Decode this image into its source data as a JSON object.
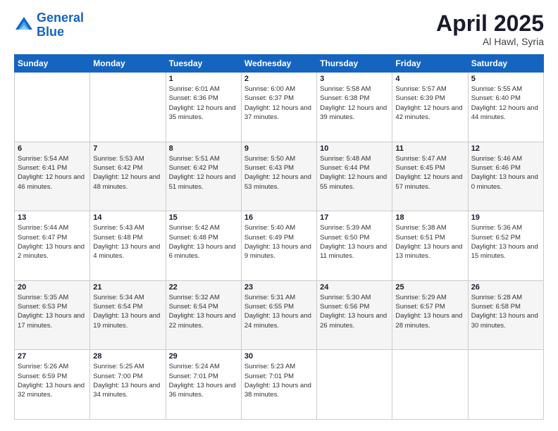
{
  "header": {
    "logo_line1": "General",
    "logo_line2": "Blue",
    "title": "April 2025",
    "subtitle": "Al Hawl, Syria"
  },
  "columns": [
    "Sunday",
    "Monday",
    "Tuesday",
    "Wednesday",
    "Thursday",
    "Friday",
    "Saturday"
  ],
  "weeks": [
    [
      {
        "day": "",
        "sunrise": "",
        "sunset": "",
        "daylight": ""
      },
      {
        "day": "",
        "sunrise": "",
        "sunset": "",
        "daylight": ""
      },
      {
        "day": "1",
        "sunrise": "Sunrise: 6:01 AM",
        "sunset": "Sunset: 6:36 PM",
        "daylight": "Daylight: 12 hours and 35 minutes."
      },
      {
        "day": "2",
        "sunrise": "Sunrise: 6:00 AM",
        "sunset": "Sunset: 6:37 PM",
        "daylight": "Daylight: 12 hours and 37 minutes."
      },
      {
        "day": "3",
        "sunrise": "Sunrise: 5:58 AM",
        "sunset": "Sunset: 6:38 PM",
        "daylight": "Daylight: 12 hours and 39 minutes."
      },
      {
        "day": "4",
        "sunrise": "Sunrise: 5:57 AM",
        "sunset": "Sunset: 6:39 PM",
        "daylight": "Daylight: 12 hours and 42 minutes."
      },
      {
        "day": "5",
        "sunrise": "Sunrise: 5:55 AM",
        "sunset": "Sunset: 6:40 PM",
        "daylight": "Daylight: 12 hours and 44 minutes."
      }
    ],
    [
      {
        "day": "6",
        "sunrise": "Sunrise: 5:54 AM",
        "sunset": "Sunset: 6:41 PM",
        "daylight": "Daylight: 12 hours and 46 minutes."
      },
      {
        "day": "7",
        "sunrise": "Sunrise: 5:53 AM",
        "sunset": "Sunset: 6:42 PM",
        "daylight": "Daylight: 12 hours and 48 minutes."
      },
      {
        "day": "8",
        "sunrise": "Sunrise: 5:51 AM",
        "sunset": "Sunset: 6:42 PM",
        "daylight": "Daylight: 12 hours and 51 minutes."
      },
      {
        "day": "9",
        "sunrise": "Sunrise: 5:50 AM",
        "sunset": "Sunset: 6:43 PM",
        "daylight": "Daylight: 12 hours and 53 minutes."
      },
      {
        "day": "10",
        "sunrise": "Sunrise: 5:48 AM",
        "sunset": "Sunset: 6:44 PM",
        "daylight": "Daylight: 12 hours and 55 minutes."
      },
      {
        "day": "11",
        "sunrise": "Sunrise: 5:47 AM",
        "sunset": "Sunset: 6:45 PM",
        "daylight": "Daylight: 12 hours and 57 minutes."
      },
      {
        "day": "12",
        "sunrise": "Sunrise: 5:46 AM",
        "sunset": "Sunset: 6:46 PM",
        "daylight": "Daylight: 13 hours and 0 minutes."
      }
    ],
    [
      {
        "day": "13",
        "sunrise": "Sunrise: 5:44 AM",
        "sunset": "Sunset: 6:47 PM",
        "daylight": "Daylight: 13 hours and 2 minutes."
      },
      {
        "day": "14",
        "sunrise": "Sunrise: 5:43 AM",
        "sunset": "Sunset: 6:48 PM",
        "daylight": "Daylight: 13 hours and 4 minutes."
      },
      {
        "day": "15",
        "sunrise": "Sunrise: 5:42 AM",
        "sunset": "Sunset: 6:48 PM",
        "daylight": "Daylight: 13 hours and 6 minutes."
      },
      {
        "day": "16",
        "sunrise": "Sunrise: 5:40 AM",
        "sunset": "Sunset: 6:49 PM",
        "daylight": "Daylight: 13 hours and 9 minutes."
      },
      {
        "day": "17",
        "sunrise": "Sunrise: 5:39 AM",
        "sunset": "Sunset: 6:50 PM",
        "daylight": "Daylight: 13 hours and 11 minutes."
      },
      {
        "day": "18",
        "sunrise": "Sunrise: 5:38 AM",
        "sunset": "Sunset: 6:51 PM",
        "daylight": "Daylight: 13 hours and 13 minutes."
      },
      {
        "day": "19",
        "sunrise": "Sunrise: 5:36 AM",
        "sunset": "Sunset: 6:52 PM",
        "daylight": "Daylight: 13 hours and 15 minutes."
      }
    ],
    [
      {
        "day": "20",
        "sunrise": "Sunrise: 5:35 AM",
        "sunset": "Sunset: 6:53 PM",
        "daylight": "Daylight: 13 hours and 17 minutes."
      },
      {
        "day": "21",
        "sunrise": "Sunrise: 5:34 AM",
        "sunset": "Sunset: 6:54 PM",
        "daylight": "Daylight: 13 hours and 19 minutes."
      },
      {
        "day": "22",
        "sunrise": "Sunrise: 5:32 AM",
        "sunset": "Sunset: 6:54 PM",
        "daylight": "Daylight: 13 hours and 22 minutes."
      },
      {
        "day": "23",
        "sunrise": "Sunrise: 5:31 AM",
        "sunset": "Sunset: 6:55 PM",
        "daylight": "Daylight: 13 hours and 24 minutes."
      },
      {
        "day": "24",
        "sunrise": "Sunrise: 5:30 AM",
        "sunset": "Sunset: 6:56 PM",
        "daylight": "Daylight: 13 hours and 26 minutes."
      },
      {
        "day": "25",
        "sunrise": "Sunrise: 5:29 AM",
        "sunset": "Sunset: 6:57 PM",
        "daylight": "Daylight: 13 hours and 28 minutes."
      },
      {
        "day": "26",
        "sunrise": "Sunrise: 5:28 AM",
        "sunset": "Sunset: 6:58 PM",
        "daylight": "Daylight: 13 hours and 30 minutes."
      }
    ],
    [
      {
        "day": "27",
        "sunrise": "Sunrise: 5:26 AM",
        "sunset": "Sunset: 6:59 PM",
        "daylight": "Daylight: 13 hours and 32 minutes."
      },
      {
        "day": "28",
        "sunrise": "Sunrise: 5:25 AM",
        "sunset": "Sunset: 7:00 PM",
        "daylight": "Daylight: 13 hours and 34 minutes."
      },
      {
        "day": "29",
        "sunrise": "Sunrise: 5:24 AM",
        "sunset": "Sunset: 7:01 PM",
        "daylight": "Daylight: 13 hours and 36 minutes."
      },
      {
        "day": "30",
        "sunrise": "Sunrise: 5:23 AM",
        "sunset": "Sunset: 7:01 PM",
        "daylight": "Daylight: 13 hours and 38 minutes."
      },
      {
        "day": "",
        "sunrise": "",
        "sunset": "",
        "daylight": ""
      },
      {
        "day": "",
        "sunrise": "",
        "sunset": "",
        "daylight": ""
      },
      {
        "day": "",
        "sunrise": "",
        "sunset": "",
        "daylight": ""
      }
    ]
  ]
}
